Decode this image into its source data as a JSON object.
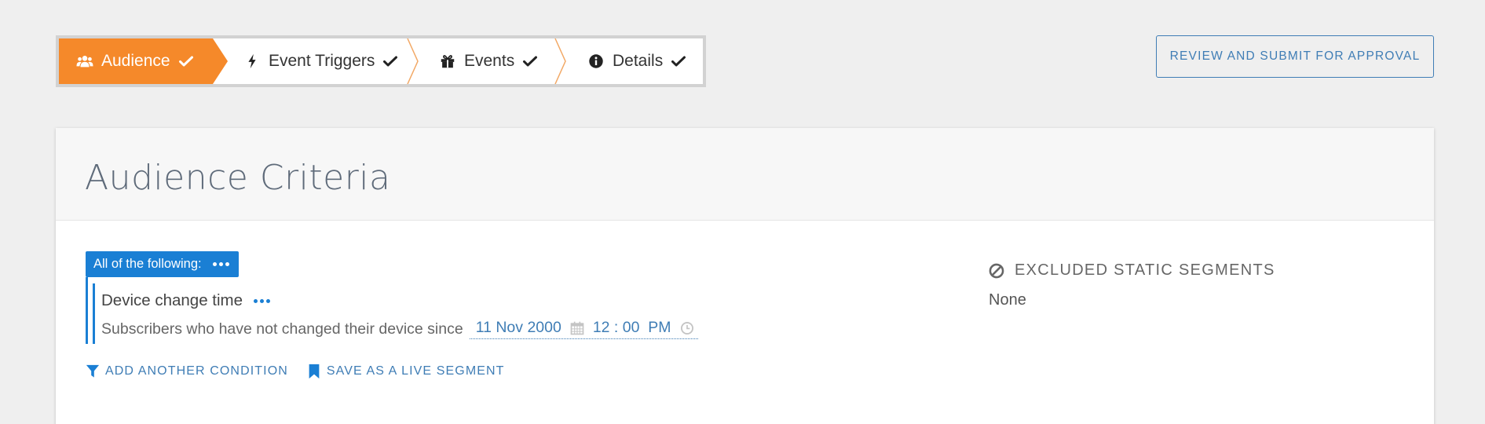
{
  "wizard": {
    "steps": [
      {
        "label": "Audience",
        "icon": "users-icon",
        "completed": true,
        "active": true
      },
      {
        "label": "Event Triggers",
        "icon": "bolt-icon",
        "completed": true,
        "active": false
      },
      {
        "label": "Events",
        "icon": "gift-icon",
        "completed": true,
        "active": false
      },
      {
        "label": "Details",
        "icon": "info-circle-icon",
        "completed": true,
        "active": false
      }
    ],
    "active_color": "#f5892a"
  },
  "header": {
    "review_button_label": "REVIEW AND SUBMIT FOR APPROVAL"
  },
  "card": {
    "title": "Audience Criteria",
    "group": {
      "label": "All of the following:",
      "condition": {
        "title": "Device change time",
        "description": "Subscribers who have not changed their device since",
        "date": "11 Nov 2000",
        "time": "12 : 00  PM"
      }
    },
    "actions": {
      "add_condition": "ADD ANOTHER CONDITION",
      "save_segment": "SAVE AS A LIVE SEGMENT"
    },
    "excluded": {
      "title": "EXCLUDED STATIC SEGMENTS",
      "value": "None"
    }
  },
  "colors": {
    "accent_blue": "#1a7fd4",
    "link_blue": "#3f7db5",
    "active_step": "#f5892a"
  }
}
